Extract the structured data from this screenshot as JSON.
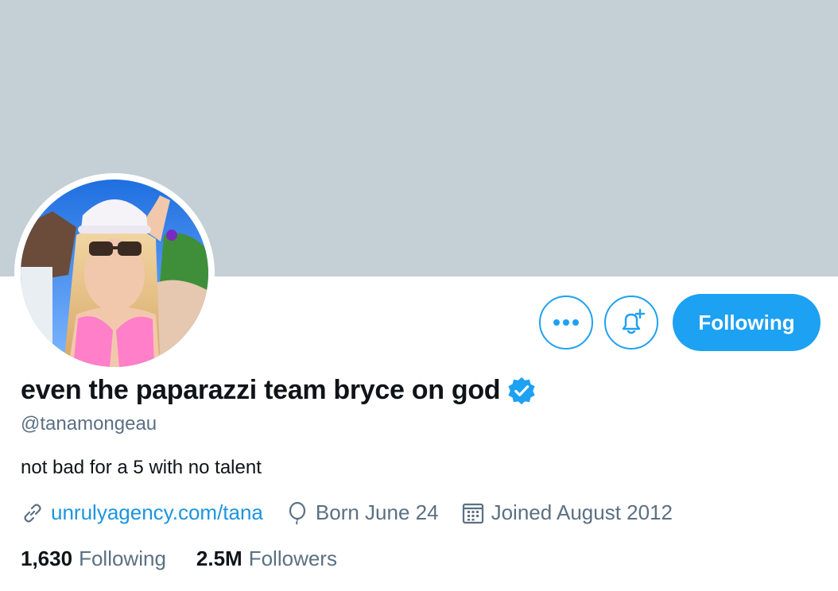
{
  "profile": {
    "display_name": "even the paparazzi team bryce on god",
    "handle": "@tanamongeau",
    "bio": "not bad for a 5 with no talent",
    "verified": true
  },
  "meta": {
    "website": "unrulyagency.com/tana",
    "birthday": "Born June 24",
    "joined": "Joined August 2012"
  },
  "stats": {
    "following_count": "1,630",
    "following_label": "Following",
    "followers_count": "2.5M",
    "followers_label": "Followers"
  },
  "actions": {
    "follow_button_label": "Following"
  },
  "icons": {
    "more": "more-dots-icon",
    "notify": "bell-plus-icon",
    "verified": "verified-badge-icon",
    "link": "link-icon",
    "birthday": "balloon-icon",
    "calendar": "calendar-icon"
  },
  "colors": {
    "accent": "#1da1f2",
    "banner": "#c4cfd6",
    "secondary_text": "#5b7083",
    "primary_text": "#0f1419"
  }
}
